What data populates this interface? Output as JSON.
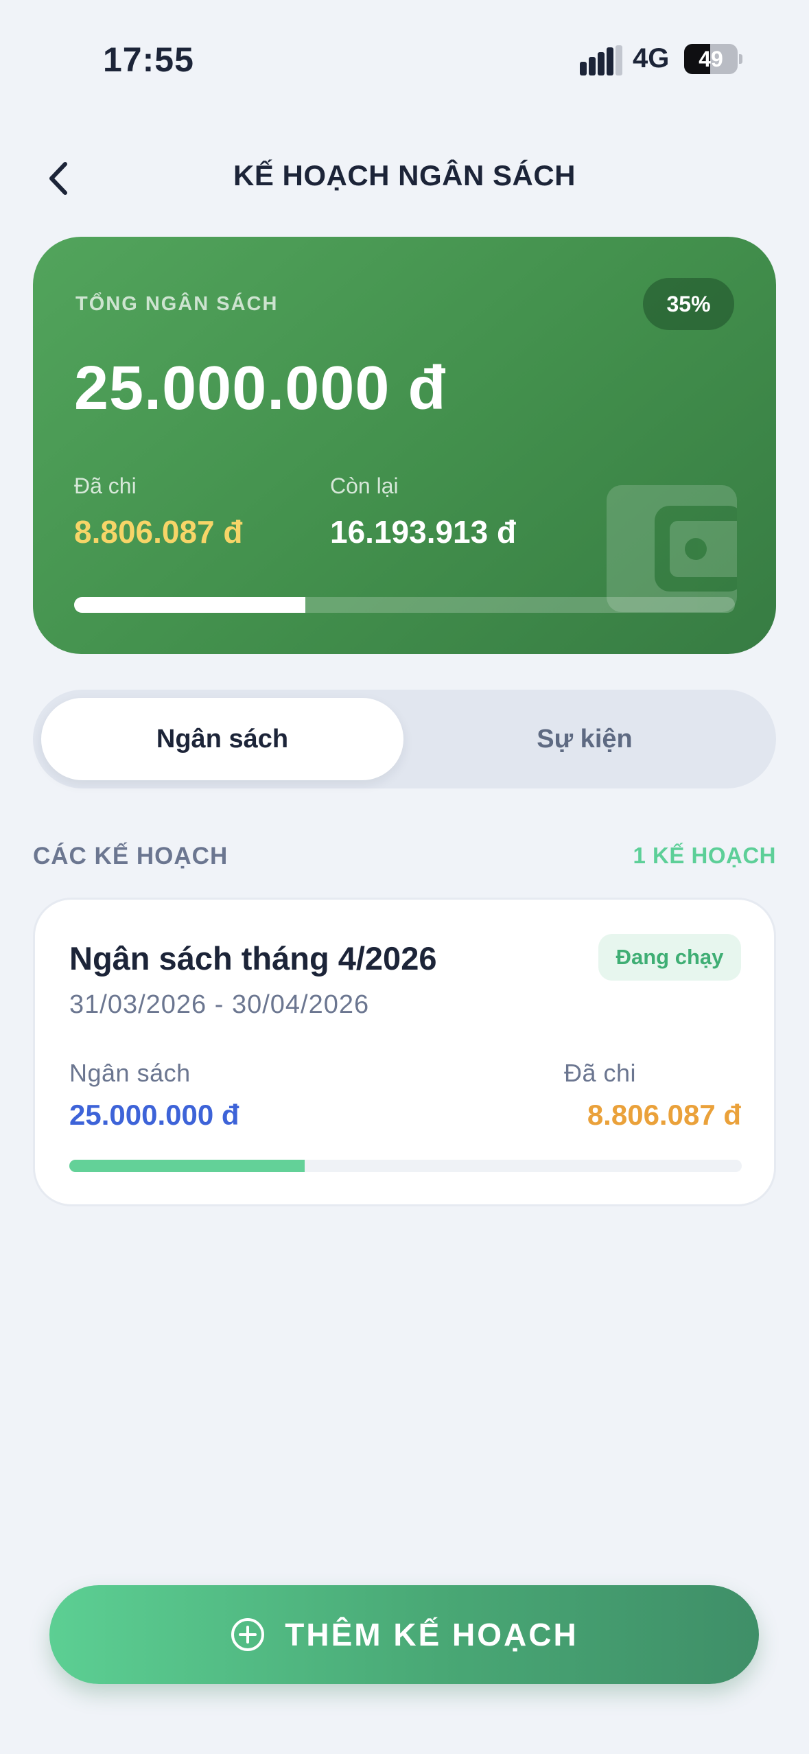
{
  "status_bar": {
    "time": "17:55",
    "network": "4G",
    "battery": "49",
    "battery_level": 0.49
  },
  "header": {
    "title": "KẾ HOẠCH NGÂN SÁCH",
    "back_icon": "chevron-left-icon"
  },
  "summary": {
    "label": "TỔNG NGÂN SÁCH",
    "percent": "35%",
    "total": "25.000.000 đ",
    "spent_label": "Đã chi",
    "spent_value": "8.806.087 đ",
    "remaining_label": "Còn lại",
    "remaining_value": "16.193.913 đ",
    "progress": 0.35,
    "wallet_icon": "wallet-icon"
  },
  "tabs": [
    {
      "label": "Ngân sách",
      "active": true
    },
    {
      "label": "Sự kiện",
      "active": false
    }
  ],
  "section": {
    "title": "CÁC KẾ HOẠCH",
    "count": "1 KẾ HOẠCH"
  },
  "plans": [
    {
      "name": "Ngân sách tháng 4/2026",
      "status": "Đang chạy",
      "dates": "31/03/2026 - 30/04/2026",
      "budget_label": "Ngân sách",
      "budget_value": "25.000.000 đ",
      "spent_label": "Đã chi",
      "spent_value": "8.806.087 đ",
      "progress": 0.35
    }
  ],
  "add_button": {
    "label": "THÊM KẾ HOẠCH",
    "icon": "plus-circle-icon"
  },
  "colors": {
    "card_green": "#4a9a54",
    "spent_yellow": "#f7d568",
    "accent_mint": "#5dcf98",
    "budget_blue": "#3d63d8",
    "spent_orange": "#eaa13a",
    "background": "#f0f3f8"
  }
}
